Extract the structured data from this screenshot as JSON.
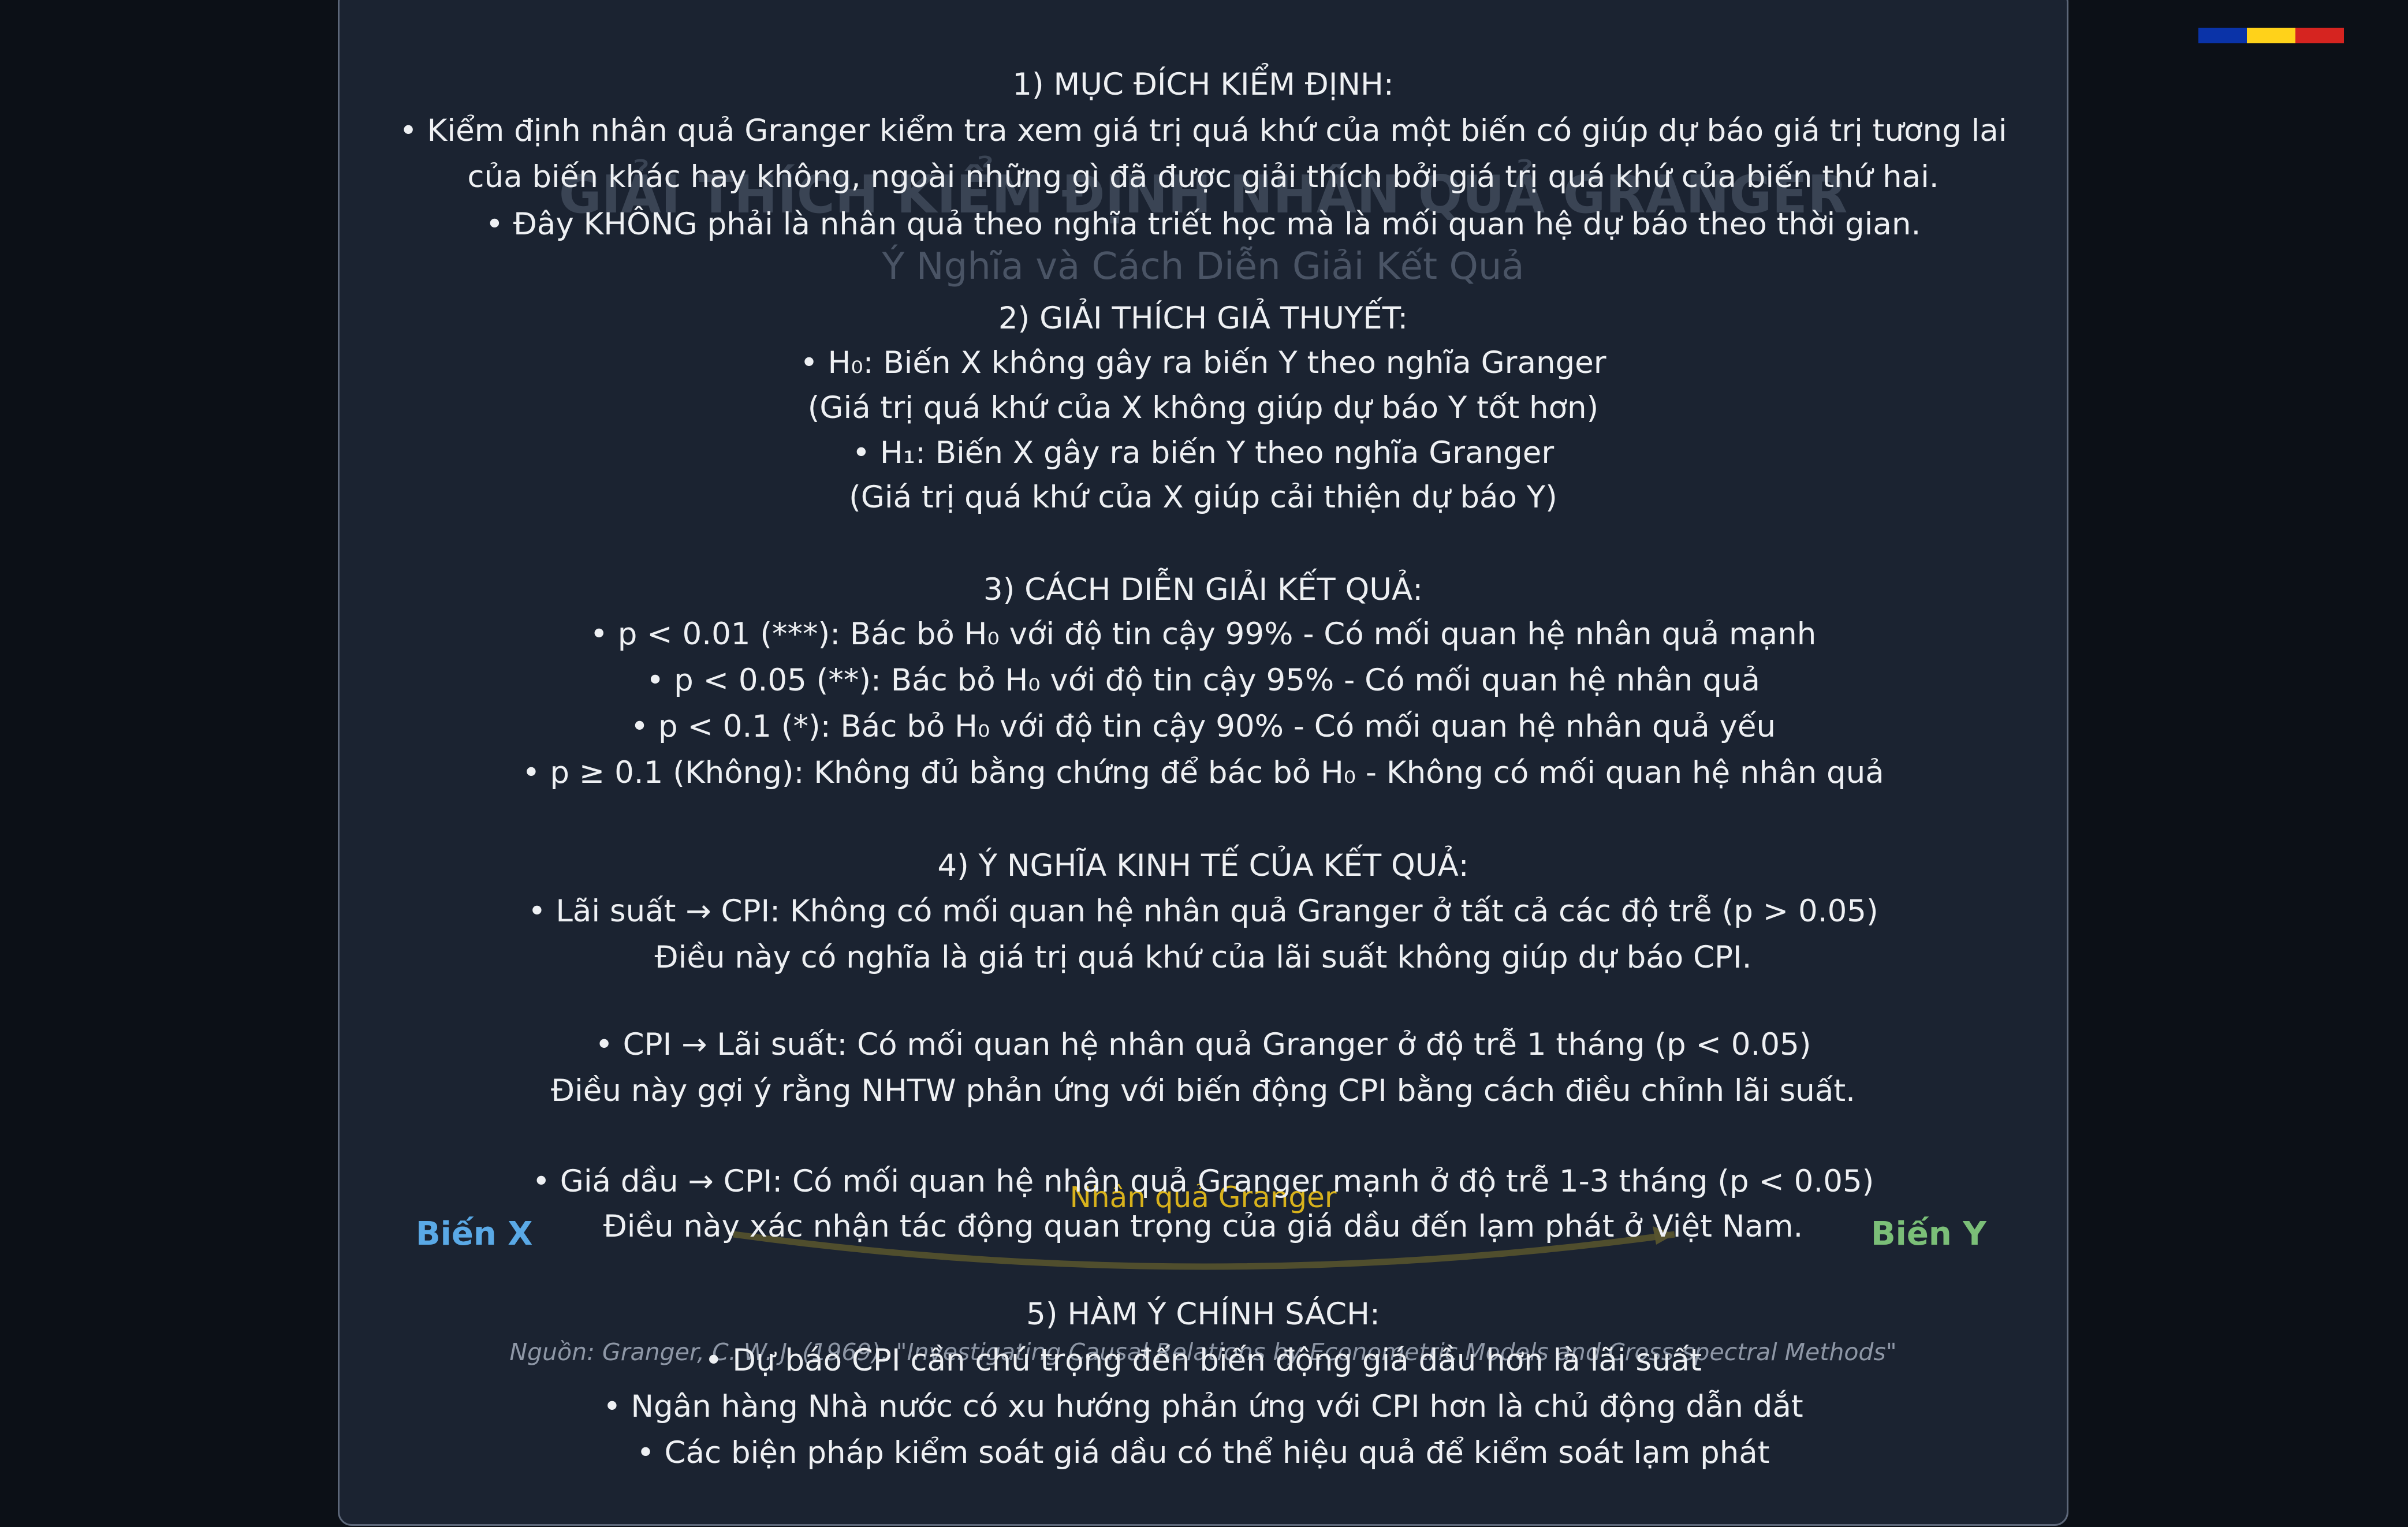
{
  "flag_colors": [
    "#0a33a8",
    "#ffd21a",
    "#d62420"
  ],
  "background": {
    "title": "GIẢI THÍCH KIỂM ĐỊNH NHÂN QUẢ GRANGER",
    "subtitle": "Ý Nghĩa và Cách Diễn Giải Kết Quả"
  },
  "diagram": {
    "var_x": "Biến X",
    "var_y": "Biến Y",
    "arrow_label": "Nhân quả Granger",
    "var_x_color": "#5aa9e6",
    "var_y_color": "#7bbf78",
    "arrow_color": "#d8b21c",
    "source": "Nguồn: Granger, C. W. J. (1969). \"Investigating Causal Relations by Econometric Models and Cross-spectral Methods\""
  },
  "content": {
    "lines": [
      "1) MỤC ĐÍCH KIỂM ĐỊNH:",
      "• Kiểm định nhân quả Granger kiểm tra xem giá trị quá khứ của một biến có giúp dự báo giá trị tương lai",
      "của biến khác hay không, ngoài những gì đã được giải thích bởi giá trị quá khứ của biến thứ hai.",
      "• Đây KHÔNG phải là nhân quả theo nghĩa triết học mà là mối quan hệ dự báo theo thời gian.",
      "2) GIẢI THÍCH GIẢ THUYẾT:",
      "• H₀: Biến X không gây ra biến Y theo nghĩa Granger",
      "(Giá trị quá khứ của X không giúp dự báo Y tốt hơn)",
      "• H₁: Biến X gây ra biến Y theo nghĩa Granger",
      "(Giá trị quá khứ của X giúp cải thiện dự báo Y)",
      "3) CÁCH DIỄN GIẢI KẾT QUẢ:",
      "• p < 0.01 (***): Bác bỏ H₀ với độ tin cậy 99% - Có mối quan hệ nhân quả mạnh",
      "• p < 0.05 (**): Bác bỏ H₀ với độ tin cậy 95% - Có mối quan hệ nhân quả",
      "• p < 0.1 (*): Bác bỏ H₀ với độ tin cậy 90% - Có mối quan hệ nhân quả yếu",
      "• p ≥ 0.1 (Không): Không đủ bằng chứng để bác bỏ H₀ - Không có mối quan hệ nhân quả",
      "4) Ý NGHĨA KINH TẾ CỦA KẾT QUẢ:",
      "• Lãi suất → CPI: Không có mối quan hệ nhân quả Granger ở tất cả các độ trễ (p > 0.05)",
      "Điều này có nghĩa là giá trị quá khứ của lãi suất không giúp dự báo CPI.",
      "• CPI → Lãi suất: Có mối quan hệ nhân quả Granger ở độ trễ 1 tháng (p < 0.05)",
      "Điều này gợi ý rằng NHTW phản ứng với biến động CPI bằng cách điều chỉnh lãi suất.",
      "• Giá dầu → CPI: Có mối quan hệ nhân quả Granger mạnh ở độ trễ 1-3 tháng (p < 0.05)",
      "Điều này xác nhận tác động quan trọng của giá dầu đến lạm phát ở Việt Nam.",
      "5) HÀM Ý CHÍNH SÁCH:",
      "• Dự báo CPI cần chú trọng đến biến động giá dầu hơn là lãi suất",
      "• Ngân hàng Nhà nước có xu hướng phản ứng với CPI hơn là chủ động dẫn dắt",
      "• Các biện pháp kiểm soát giá dầu có thể hiệu quả để kiểm soát lạm phát"
    ]
  }
}
